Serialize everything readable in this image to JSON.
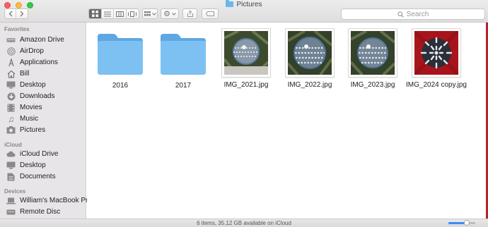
{
  "window": {
    "title": "Pictures"
  },
  "toolbar": {
    "back_icon": "chevron-left-icon",
    "forward_icon": "chevron-right-icon",
    "view_modes": [
      "icon-view",
      "list-view",
      "column-view",
      "cover-flow-view"
    ],
    "active_view": "icon-view",
    "search_placeholder": "Search"
  },
  "sidebar": {
    "sections": [
      {
        "header": "Favorites",
        "items": [
          {
            "label": "Amazon Drive",
            "icon": "drive-icon"
          },
          {
            "label": "AirDrop",
            "icon": "airdrop-icon"
          },
          {
            "label": "Applications",
            "icon": "applications-icon"
          },
          {
            "label": "Bill",
            "icon": "home-icon"
          },
          {
            "label": "Desktop",
            "icon": "desktop-icon"
          },
          {
            "label": "Downloads",
            "icon": "downloads-icon"
          },
          {
            "label": "Movies",
            "icon": "movies-icon"
          },
          {
            "label": "Music",
            "icon": "music-icon"
          },
          {
            "label": "Pictures",
            "icon": "pictures-icon"
          }
        ]
      },
      {
        "header": "iCloud",
        "items": [
          {
            "label": "iCloud Drive",
            "icon": "cloud-icon"
          },
          {
            "label": "Desktop",
            "icon": "desktop-icon"
          },
          {
            "label": "Documents",
            "icon": "documents-icon"
          }
        ]
      },
      {
        "header": "Devices",
        "items": [
          {
            "label": "William's MacBook Pro",
            "icon": "laptop-icon"
          },
          {
            "label": "Remote Disc",
            "icon": "disc-icon"
          }
        ]
      }
    ]
  },
  "files": [
    {
      "name": "2016",
      "kind": "folder"
    },
    {
      "name": "2017",
      "kind": "folder"
    },
    {
      "name": "IMG_2021.jpg",
      "kind": "image"
    },
    {
      "name": "IMG_2022.jpg",
      "kind": "image"
    },
    {
      "name": "IMG_2023.jpg",
      "kind": "image"
    },
    {
      "name": "IMG_2024 copy.jpg",
      "kind": "image"
    }
  ],
  "status": {
    "text": "6 items, 35.12 GB available on iCloud"
  },
  "colors": {
    "accent": "#3b8cf5",
    "folder": "#6cb6ee",
    "desktop_bg": "#b5232a"
  }
}
